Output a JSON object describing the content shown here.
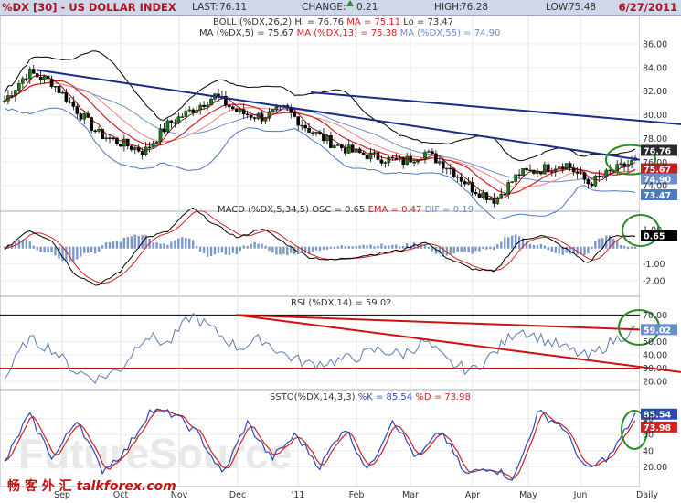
{
  "header": {
    "symbol": "%DX [30] - US DOLLAR INDEX",
    "last_label": "LAST:",
    "last": "76.11",
    "change_label": "CHANGE:",
    "change": "0.21",
    "high_label": "HIGH:",
    "high": "76.28",
    "low_label": "LOW:",
    "low": "75.48",
    "date": "6/27/2011"
  },
  "panels": {
    "price": {
      "boll_prefix": "BOLL (%DX,26,2)",
      "boll_hi": "Hi = 76.76",
      "boll_ma": "MA = 75.11",
      "boll_lo": "Lo = 73.47",
      "ma_prefix": "MA (%DX,5) = 75.67",
      "ma13": "MA (%DX,13) = 75.38",
      "ma55": "MA (%DX,55) = 74.90",
      "yticks": [
        "86.00",
        "84.00",
        "82.00",
        "80.00",
        "78.00",
        "76.00",
        "74.00"
      ],
      "value_tags": [
        "76.76",
        "75.67",
        "74.90",
        "73.47"
      ]
    },
    "macd": {
      "prefix": "MACD (%DX,5,34,5)",
      "osc": "OSC = 0.65",
      "ema": "EMA = 0.47",
      "dif": "DIF = 0.19",
      "yticks": [
        "1.00",
        "-1.00",
        "-2.00"
      ],
      "value_tag": "0.65"
    },
    "rsi": {
      "label": "RSI (%DX,14) = 59.02",
      "yticks": [
        "70.00",
        "50.00",
        "40.00",
        "30.00",
        "20.00"
      ],
      "value_tag": "59.02"
    },
    "ssto": {
      "prefix": "SSTO(%DX,14,3,3)",
      "k": "%K = 85.54",
      "d": "%D = 73.98",
      "yticks": [
        "80",
        "60",
        "40",
        "20.00"
      ],
      "value_tags": [
        "85.54",
        "73.98"
      ]
    }
  },
  "x_axis": [
    "Sep",
    "Oct",
    "Nov",
    "Dec",
    "'11",
    "Feb",
    "Mar",
    "Apr",
    "May",
    "Jun",
    "Daily"
  ],
  "watermark": {
    "cn": "畅 客 外 汇",
    "en": "talkforex.com"
  },
  "background_mark": "FutureSource",
  "colors": {
    "title_red": "#b01020",
    "bar_green": "#1a7a1a",
    "bar_black": "#000000",
    "trend_navy": "#1a2a8a",
    "trend_red": "#d01010",
    "ma_red": "#d02020",
    "band": "#000000",
    "ma_blue": "#6a8ec8",
    "circle": "#2a8a2a"
  },
  "chart_data": [
    {
      "type": "candlestick",
      "title": "%DX [30] - US DOLLAR INDEX",
      "x": [
        "Sep",
        "Oct",
        "Nov",
        "Dec",
        "'11",
        "Feb",
        "Mar",
        "Apr",
        "May",
        "Jun"
      ],
      "close": [
        81.2,
        83.6,
        82.8,
        80.6,
        78.4,
        77.6,
        76.9,
        79.2,
        80.4,
        81.6,
        80.2,
        79.8,
        80.5,
        78.8,
        77.6,
        76.8,
        76.4,
        76.0,
        76.8,
        75.6,
        73.8,
        72.8,
        75.0,
        75.4,
        75.9,
        74.2,
        75.2,
        76.1
      ],
      "ylim": [
        72,
        87
      ],
      "series": [
        {
          "name": "BOLL Hi",
          "last": 76.76
        },
        {
          "name": "BOLL MA",
          "last": 75.11
        },
        {
          "name": "BOLL Lo",
          "last": 73.47
        },
        {
          "name": "MA (%DX,5)",
          "last": 75.67
        },
        {
          "name": "MA (%DX,13)",
          "last": 75.38
        },
        {
          "name": "MA (%DX,55)",
          "last": 74.9
        }
      ]
    },
    {
      "type": "line",
      "title": "MACD (%DX,5,34,5)",
      "osc": 0.65,
      "ema": 0.47,
      "dif": 0.19,
      "values": [
        -0.2,
        1.0,
        0.4,
        -1.6,
        -2.3,
        -1.4,
        0.5,
        0.9,
        2.3,
        1.3,
        0.5,
        1.1,
        0.2,
        -0.6,
        -0.8,
        -0.6,
        -0.4,
        -0.2,
        0.3,
        -0.7,
        -1.3,
        -1.5,
        0.3,
        0.7,
        -0.1,
        -1.0,
        0.6,
        0.65
      ],
      "ylim": [
        -2.6,
        1.6
      ]
    },
    {
      "type": "line",
      "title": "RSI (%DX,14) = 59.02",
      "values": [
        22,
        52,
        45,
        28,
        22,
        30,
        55,
        48,
        70,
        58,
        45,
        52,
        40,
        33,
        35,
        38,
        44,
        40,
        50,
        34,
        28,
        42,
        60,
        52,
        45,
        38,
        50,
        59.02
      ],
      "ylim": [
        18,
        73
      ],
      "reference_lines": [
        70,
        30
      ]
    },
    {
      "type": "line",
      "title": "SSTO(%DX,14,3,3)",
      "series": [
        {
          "name": "%K",
          "values": [
            25,
            85,
            30,
            80,
            15,
            40,
            90,
            85,
            60,
            10,
            75,
            30,
            60,
            20,
            70,
            15,
            80,
            30,
            65,
            10,
            20,
            5,
            88,
            70,
            15,
            35,
            85.54
          ],
          "last": 85.54
        },
        {
          "name": "%D",
          "values": [
            30,
            78,
            36,
            72,
            22,
            38,
            84,
            86,
            62,
            16,
            68,
            34,
            55,
            24,
            64,
            20,
            74,
            34,
            60,
            15,
            18,
            8,
            82,
            72,
            20,
            30,
            73.98
          ],
          "last": 73.98
        }
      ],
      "ylim": [
        0,
        100
      ]
    }
  ]
}
